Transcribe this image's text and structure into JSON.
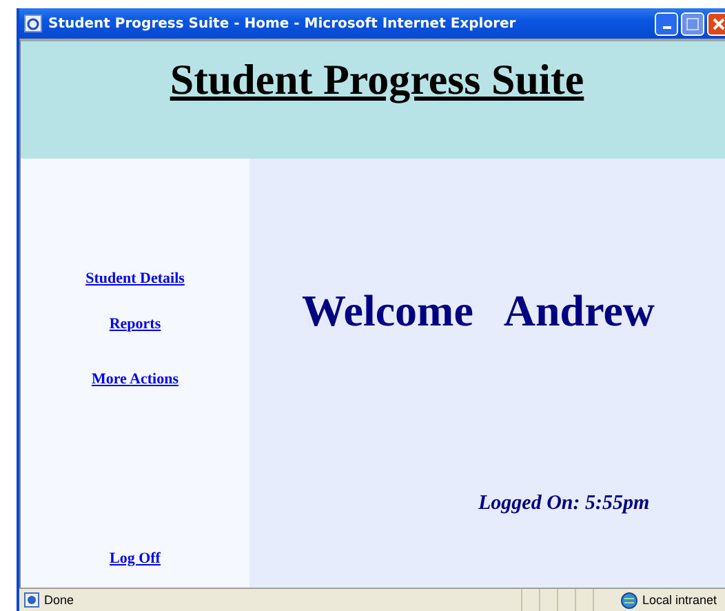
{
  "window": {
    "title": "Student Progress Suite - Home - Microsoft Internet Explorer"
  },
  "header": {
    "title": "Student Progress Suite"
  },
  "nav": {
    "items": [
      {
        "label": "Student Details"
      },
      {
        "label": "Reports"
      },
      {
        "label": "More Actions"
      }
    ],
    "logoff": "Log Off"
  },
  "welcome": {
    "greeting": "Welcome",
    "name": "Andrew"
  },
  "logged_on": "Logged On: 5:55pm",
  "status_bar": {
    "status": "Done",
    "zone": "Local intranet"
  }
}
